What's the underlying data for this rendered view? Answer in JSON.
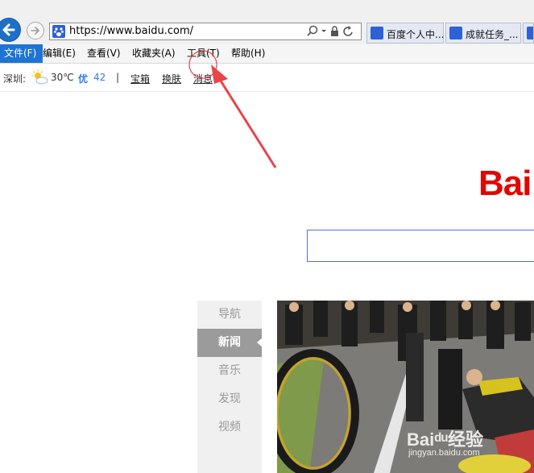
{
  "browser": {
    "url": "https://www.baidu.com/",
    "tabs": [
      {
        "label": "百度个人中..."
      },
      {
        "label": "成就任务_..."
      }
    ]
  },
  "menu": {
    "items": [
      {
        "label": "文件(F)"
      },
      {
        "label": "编辑(E)"
      },
      {
        "label": "查看(V)"
      },
      {
        "label": "收藏夹(A)"
      },
      {
        "label": "工具(T)"
      },
      {
        "label": "帮助(H)"
      }
    ],
    "active_index": 0
  },
  "status": {
    "city": "深圳:",
    "weather_icon": "sun-cloud-icon",
    "temperature": "30℃",
    "air_quality_label": "优",
    "air_quality_value": "42",
    "separator": "|",
    "links": [
      "宝箱",
      "换肤",
      "消息"
    ]
  },
  "main": {
    "logo_text": "Bai",
    "logo_color": "#e10601",
    "search_value": ""
  },
  "side_menu": {
    "items": [
      "导航",
      "新闻",
      "音乐",
      "发现",
      "视频"
    ],
    "active_index": 1
  },
  "watermark": {
    "main": "Baiᵈᵘ经验",
    "sub": "jingyan.baidu.com"
  },
  "annotation": {
    "color": "#e8454a"
  }
}
